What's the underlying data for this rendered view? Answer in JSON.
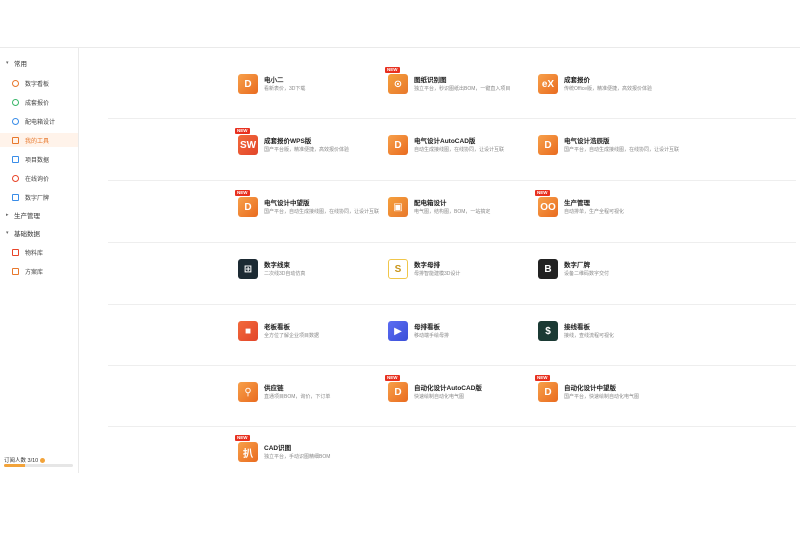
{
  "sidebar": {
    "groups": [
      {
        "label": "常用"
      },
      {
        "label": "生产管理"
      },
      {
        "label": "基础数据"
      }
    ],
    "common_items": [
      {
        "label": "数字看板",
        "icon": "clock-icon"
      },
      {
        "label": "成套报价",
        "icon": "check-circle-icon"
      },
      {
        "label": "配电箱设计",
        "icon": "box-icon"
      },
      {
        "label": "我的工具",
        "icon": "tool-icon"
      },
      {
        "label": "项目数据",
        "icon": "grid-icon"
      },
      {
        "label": "在线询价",
        "icon": "price-icon"
      },
      {
        "label": "数字厂牌",
        "icon": "nameplate-icon"
      }
    ],
    "base_items": [
      {
        "label": "物料库",
        "icon": "material-icon"
      },
      {
        "label": "方案库",
        "icon": "plan-icon"
      }
    ],
    "quota_label": "订阅人数 3/10",
    "quota_fraction": 0.3,
    "quota_icon": "info-icon"
  },
  "apps": [
    {
      "title": "电小二",
      "desc": "看新表价，3D下载",
      "glyph": "D",
      "new": false
    },
    {
      "title": "图纸识别图",
      "desc": "独立平台，秒识图纸出BOM，一键直入项目",
      "glyph": "⊙",
      "new": true
    },
    {
      "title": "成套报价",
      "desc": "传统Office版，精准便捷，高效报价体验",
      "glyph": "eX",
      "new": false
    },
    {
      "title": "成套报价WPS版",
      "desc": "国产平台版，精准便捷，高效报价体验",
      "glyph": "SW",
      "new": true
    },
    {
      "title": "电气设计AutoCAD版",
      "desc": "自动生成接线图，在线协同，让设计互联",
      "glyph": "D",
      "new": false
    },
    {
      "title": "电气设计浩辰版",
      "desc": "国产平台，自动生成接线图，在线协同，让设计互联",
      "glyph": "D",
      "new": false
    },
    {
      "title": "电气设计中望版",
      "desc": "国产平台，自动生成接线图，在线协同，让设计互联",
      "glyph": "D",
      "new": true
    },
    {
      "title": "配电箱设计",
      "desc": "电气图，结构图，BOM，一站搞定",
      "glyph": "▣",
      "new": false
    },
    {
      "title": "生产管理",
      "desc": "自动排单，生产全程可视化",
      "glyph": "OO",
      "new": true
    },
    {
      "title": "数字线束",
      "desc": "二次线3D自动仿真",
      "glyph": "⊞",
      "new": false
    },
    {
      "title": "数字母排",
      "desc": "母排智能建模3D设计",
      "glyph": "S",
      "new": false
    },
    {
      "title": "数字厂牌",
      "desc": "设备二维码数字交付",
      "glyph": "B",
      "new": false
    },
    {
      "title": "老板看板",
      "desc": "全方位了解企业项目数据",
      "glyph": "■",
      "new": false
    },
    {
      "title": "母排看板",
      "desc": "移动端手绘母排",
      "glyph": "▶",
      "new": false
    },
    {
      "title": "接线看板",
      "desc": "接线，查线流程可视化",
      "glyph": "$",
      "new": false
    },
    {
      "title": "供应链",
      "desc": "直通项目BOM，询价，下订单",
      "glyph": "⚲",
      "new": false
    },
    {
      "title": "自动化设计AutoCAD版",
      "desc": "快速绘制自动化电气图",
      "glyph": "D",
      "new": true
    },
    {
      "title": "自动化设计中望版",
      "desc": "国产平台，快速绘制自动化电气图",
      "glyph": "D",
      "new": true
    },
    {
      "title": "CAD识图",
      "desc": "独立平台，手动识图精细BOM",
      "glyph": "扒",
      "new": true
    }
  ],
  "new_badge": "NEW"
}
